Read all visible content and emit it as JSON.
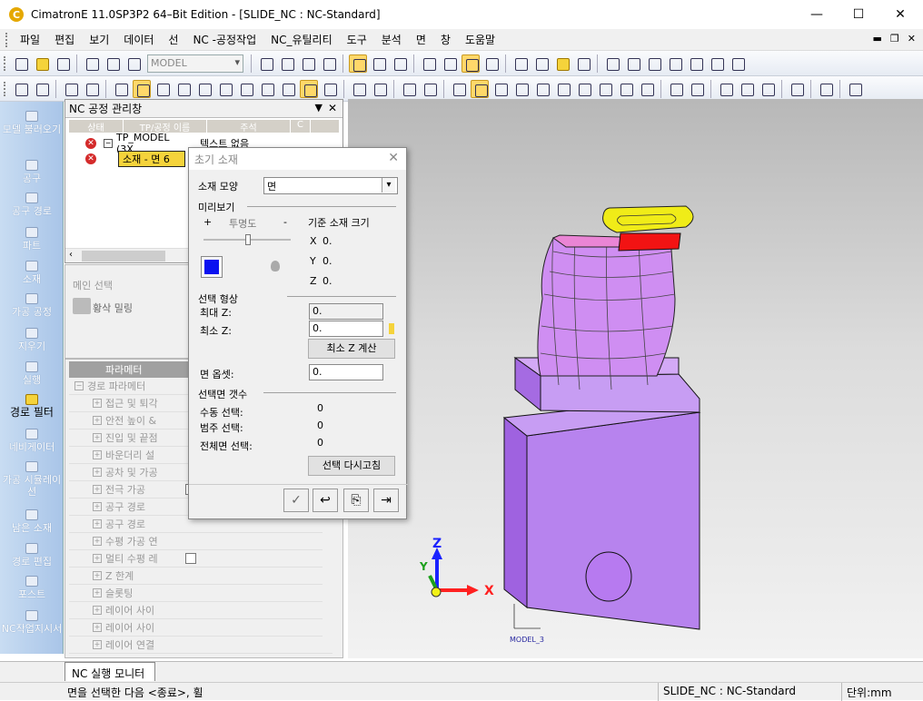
{
  "window": {
    "title": "CimatronE 11.0SP3P2 64–Bit Edition - [SLIDE_NC : NC-Standard]",
    "minimize": "—",
    "maximize": "☐",
    "close": "✕"
  },
  "menu": [
    "파일",
    "편집",
    "보기",
    "데이터",
    "선",
    "NC -공정작업",
    "NC_유틸리티",
    "도구",
    "분석",
    "면",
    "창",
    "도움말"
  ],
  "mdi_controls": {
    "min": "▬",
    "restore": "❐",
    "close": "✕"
  },
  "toolbar": {
    "model_combo": "MODEL"
  },
  "sidebar": [
    {
      "label": "모델 불러오기"
    },
    {
      "label": "공구"
    },
    {
      "label": "공구 경로"
    },
    {
      "label": "파트"
    },
    {
      "label": "소재"
    },
    {
      "label": "가공 공정"
    },
    {
      "label": "지우기"
    },
    {
      "label": "실행"
    },
    {
      "label": "경로 필터"
    },
    {
      "label": "네비게이터"
    },
    {
      "label": "가공 시뮬레이션"
    },
    {
      "label": "남은 소재"
    },
    {
      "label": "경로 편집"
    },
    {
      "label": "포스트"
    },
    {
      "label": "NC작업지시서"
    }
  ],
  "nc_manager": {
    "title": "NC 공정 관리창",
    "pin": "▼",
    "close": "✕",
    "columns": [
      "상태",
      "TP/공정 이름",
      "주석",
      "C"
    ],
    "rows": [
      {
        "name": "TP_MODEL (3X",
        "comment": "텍스트 없음"
      },
      {
        "name": "소재 - 면 6",
        "comment": ""
      }
    ]
  },
  "main_selection": {
    "label": "메인 선택",
    "value": "황삭 밀링"
  },
  "params": {
    "header": "파라메터",
    "rows": [
      "경로 파라메터",
      "접근 및 퇴각",
      "안전 높이 &",
      "진입 및 끝점",
      "바운더리 설",
      "공차 및 가공",
      "전극 가공",
      "공구 경로",
      "공구 경로",
      "수평 가공 연",
      "멀티 수평 레",
      "Z 한계",
      "슬롯팅",
      "레이어 사이",
      "레이어 사이",
      "레이어 연결"
    ]
  },
  "dialog": {
    "title": "초기 소재",
    "close": "✕",
    "shape_label": "소재 모양",
    "shape_value": "면",
    "preview_label": "미리보기",
    "transparency_plus": "+",
    "transparency_label": "투명도",
    "transparency_minus": "-",
    "ref_size_label": "기준 소재 크기",
    "x_label": "X",
    "x_value": "0.",
    "y_label": "Y",
    "y_value": "0.",
    "z_label": "Z",
    "z_value": "0.",
    "sel_shape_label": "선택 형상",
    "maxz_label": "최대 Z:",
    "maxz_value": "0.",
    "minz_label": "최소 Z:",
    "minz_value": "0.",
    "calc_minz_btn": "최소 Z 계산",
    "offset_label": "면 옵셋:",
    "offset_value": "0.",
    "face_count_label": "선택면 갯수",
    "manual_label": "수동 선택:",
    "manual_value": "0",
    "range_label": "범주 선택:",
    "range_value": "0",
    "all_label": "전체면 선택:",
    "all_value": "0",
    "reselect_btn": "선택 다시고침"
  },
  "viewport": {
    "axis_x": "X",
    "axis_y": "Y",
    "axis_z": "Z",
    "model_tag": "MODEL_3"
  },
  "monitor_tab": "NC 실행 모니터",
  "status": {
    "prompt": "면을 선택한 다음 <종료>, 휠",
    "file": "SLIDE_NC : NC-Standard",
    "unit": "단위:mm"
  }
}
